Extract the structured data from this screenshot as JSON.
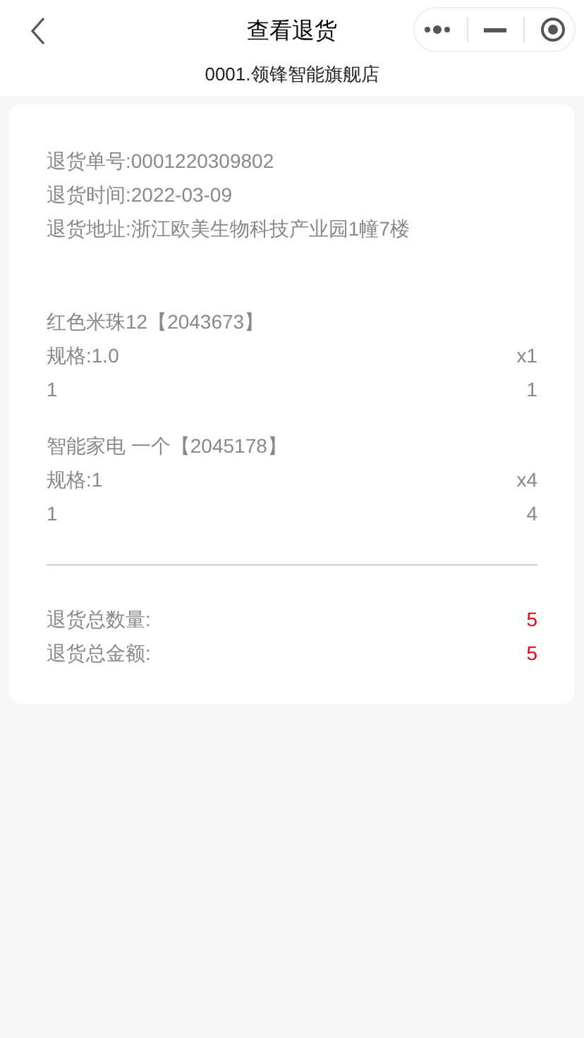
{
  "nav": {
    "title": "查看退货"
  },
  "store": "0001.领锋智能旗舰店",
  "info": [
    "退货单号:0001220309802",
    "退货时间:2022-03-09",
    "退货地址:浙江欧美生物科技产业园1幢7楼"
  ],
  "items": [
    {
      "name": "红色米珠12【2043673】",
      "spec": "规格:1.0",
      "qty": "x1",
      "column_1": "1",
      "column_2": "1"
    },
    {
      "name": "智能家电 一个【2045178】",
      "spec": "规格:1",
      "qty": "x4",
      "column_1": "1",
      "column_2": "4"
    }
  ],
  "totals": [
    {
      "label": "退货总数量:",
      "value": "5"
    },
    {
      "label": "退货总金额:",
      "value": "5"
    }
  ]
}
